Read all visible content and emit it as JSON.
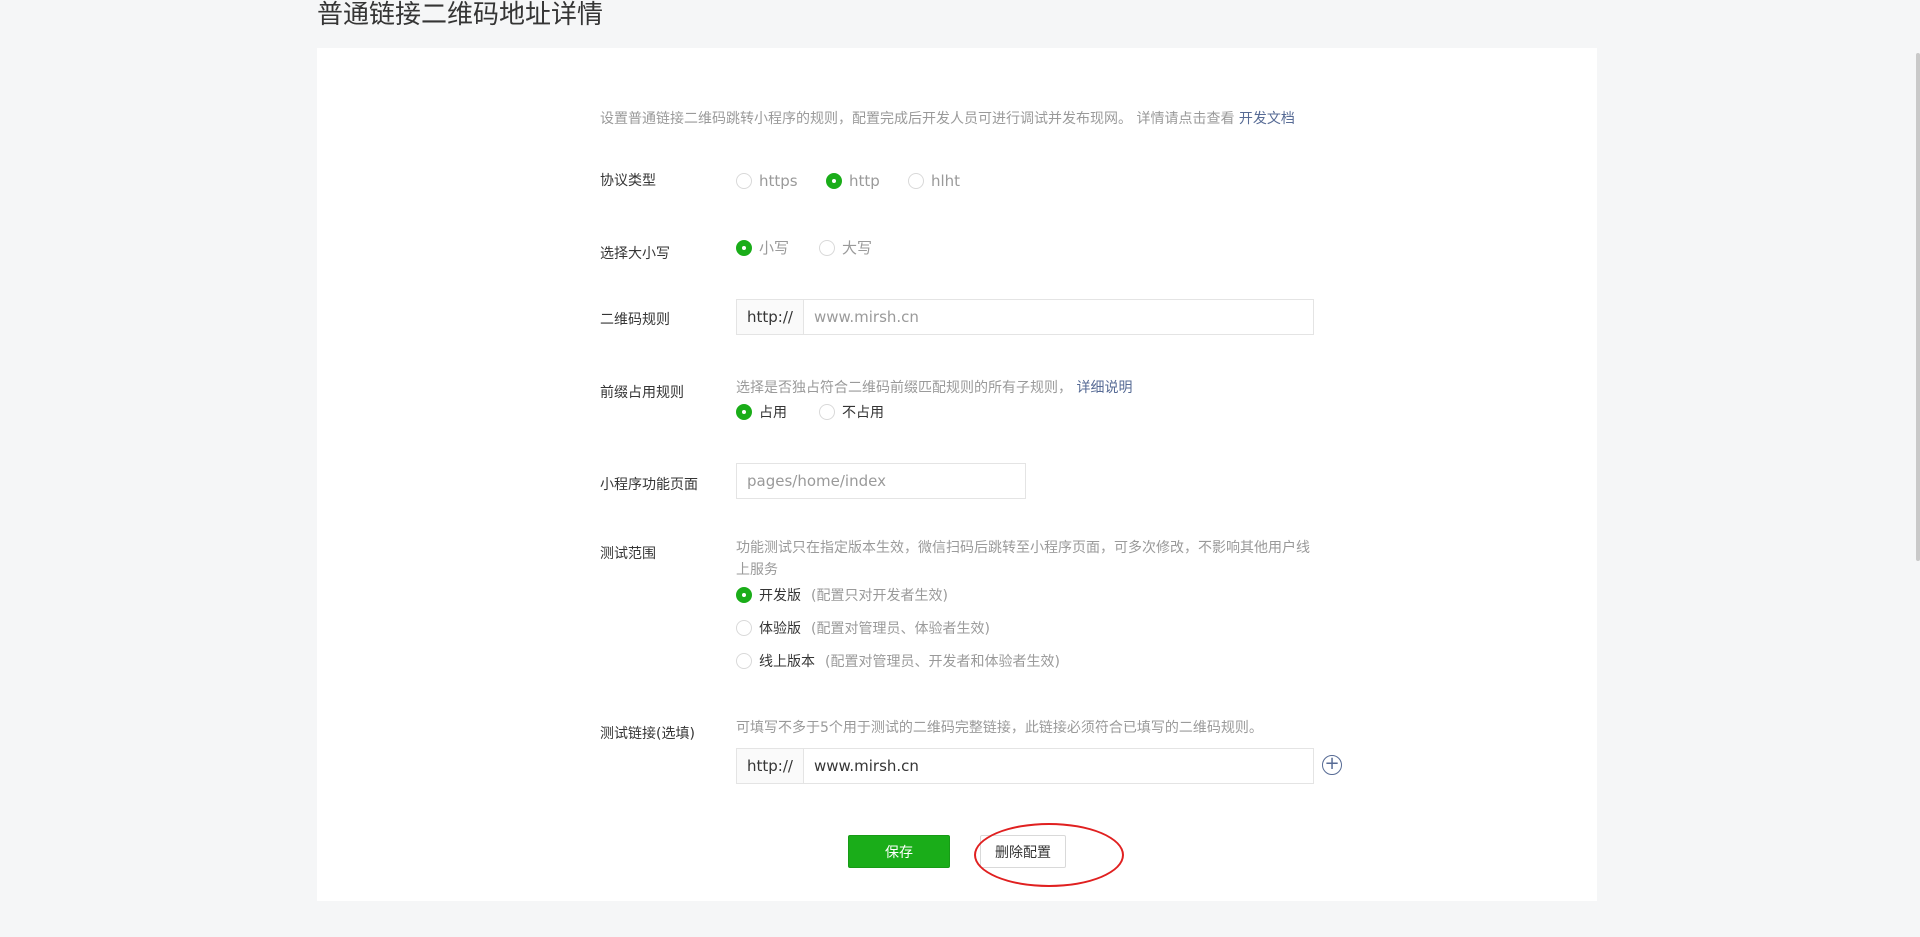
{
  "page_title": "普通链接二维码地址详情",
  "intro": {
    "text": "设置普通链接二维码跳转小程序的规则，配置完成后开发人员可进行调试并发布现网。 详情请点击查看",
    "link": "开发文档"
  },
  "protocol": {
    "label": "协议类型",
    "options": [
      "https",
      "http",
      "hlht"
    ],
    "selected": "http"
  },
  "case": {
    "label": "选择大小写",
    "options": [
      "小写",
      "大写"
    ],
    "selected": "小写"
  },
  "qr_rule": {
    "label": "二维码规则",
    "prefix": "http://",
    "placeholder": "www.mirsh.cn"
  },
  "prefix_rule": {
    "label": "前缀占用规则",
    "desc": "选择是否独占符合二维码前缀匹配规则的所有子规则，",
    "link": "详细说明",
    "options": [
      "占用",
      "不占用"
    ],
    "selected": "占用"
  },
  "page": {
    "label": "小程序功能页面",
    "placeholder": "pages/home/index"
  },
  "test_scope": {
    "label": "测试范围",
    "desc_line1": "功能测试只在指定版本生效，微信扫码后跳转至小程序页面，可多次修改，不影响其他用户线",
    "desc_line2": "上服务",
    "options": [
      {
        "name": "开发版",
        "note": "(配置只对开发者生效)"
      },
      {
        "name": "体验版",
        "note": "(配置对管理员、体验者生效)"
      },
      {
        "name": "线上版本",
        "note": "(配置对管理员、开发者和体验者生效)"
      }
    ],
    "selected": "开发版"
  },
  "test_link": {
    "label": "测试链接(选填)",
    "desc": "可填写不多于5个用于测试的二维码完整链接，此链接必须符合已填写的二维码规则。",
    "prefix": "http://",
    "value": "www.mirsh.cn",
    "add_icon": "plus-circle-icon"
  },
  "actions": {
    "save": "保存",
    "delete": "删除配置"
  },
  "colors": {
    "primary": "#1aad19",
    "link": "#576b95",
    "highlight": "#e02020"
  }
}
